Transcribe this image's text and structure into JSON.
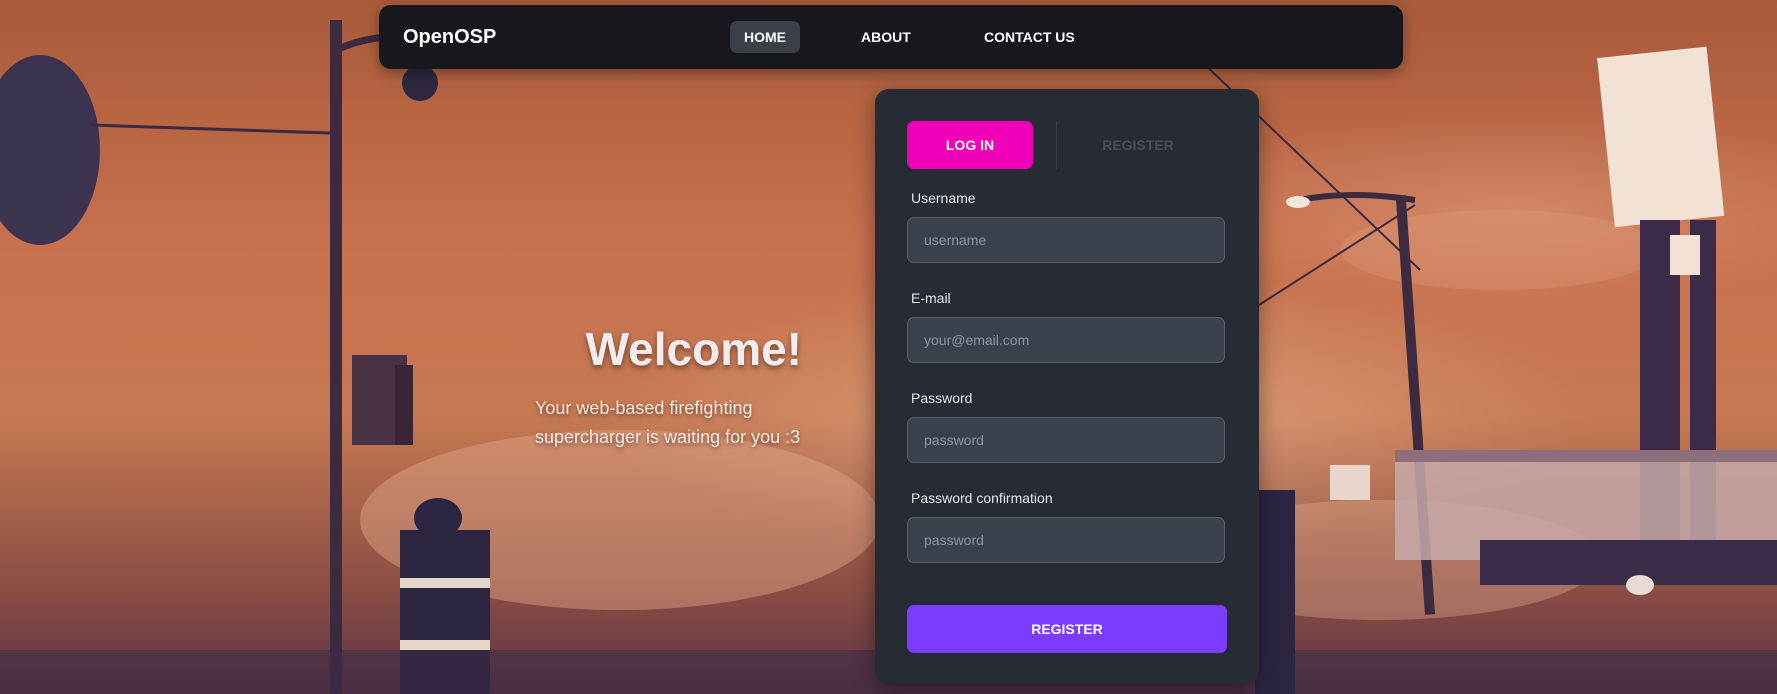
{
  "app": {
    "brand": "OpenOSP"
  },
  "nav": {
    "items": [
      {
        "label": "HOME",
        "active": true
      },
      {
        "label": "ABOUT",
        "active": false
      },
      {
        "label": "CONTACT US",
        "active": false
      }
    ]
  },
  "hero": {
    "title": "Welcome!",
    "subtitle_line1": "Your web-based firefighting",
    "subtitle_line2": "supercharger is waiting for you :3"
  },
  "auth": {
    "tabs": {
      "login": "LOG IN",
      "register": "REGISTER",
      "selected": "login"
    },
    "fields": {
      "username": {
        "label": "Username",
        "placeholder": "username",
        "value": ""
      },
      "email": {
        "label": "E-mail",
        "placeholder": "your@email.com",
        "value": ""
      },
      "password": {
        "label": "Password",
        "placeholder": "password",
        "value": ""
      },
      "password_confirm": {
        "label": "Password confirmation",
        "placeholder": "password",
        "value": ""
      }
    },
    "submit_label": "REGISTER"
  },
  "colors": {
    "accent_pink": "#f000b8",
    "accent_purple": "#7b3cff",
    "card_bg": "#272b33",
    "navbar_bg": "#17181d"
  }
}
